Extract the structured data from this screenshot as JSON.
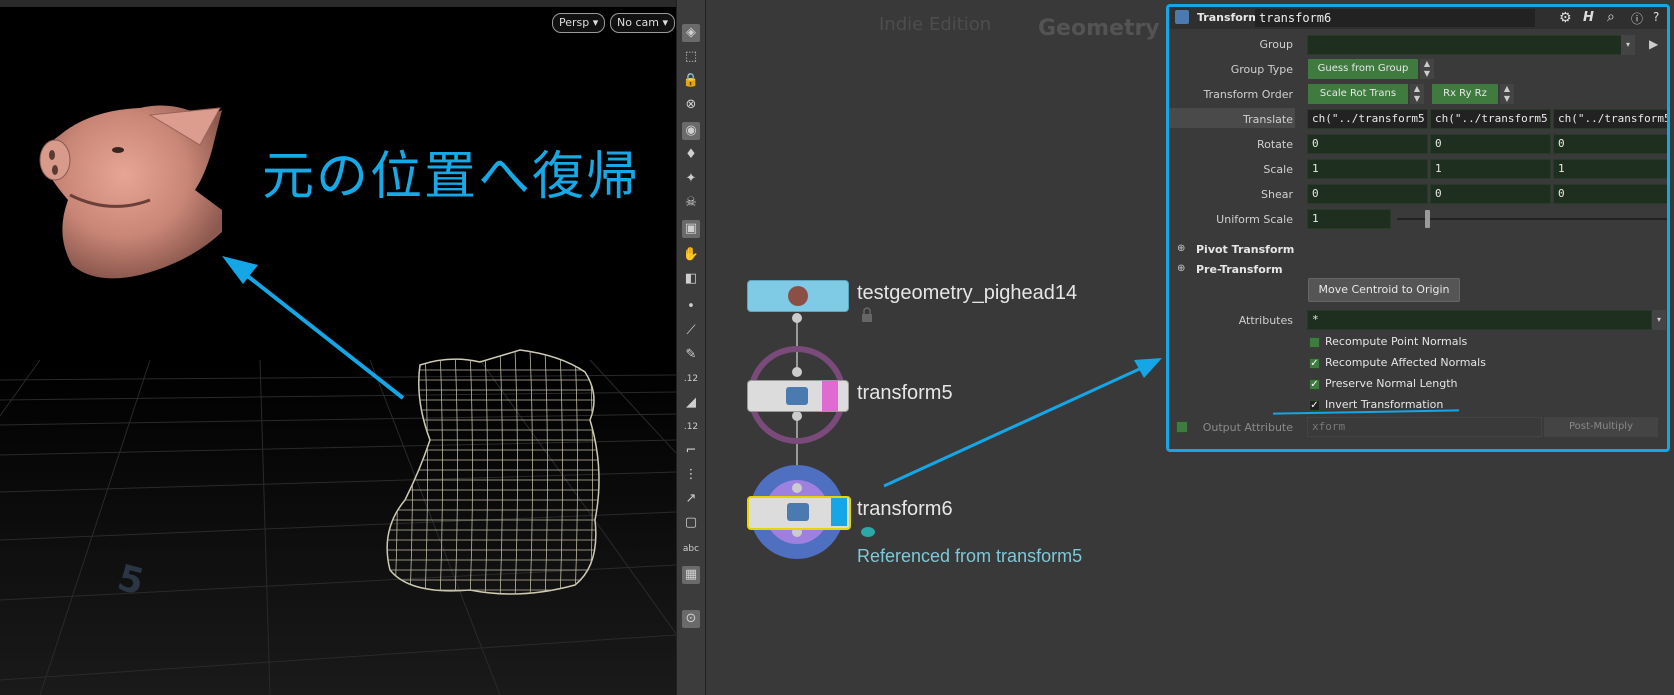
{
  "viewport": {
    "persp_label": "Persp",
    "cam_label": "No cam",
    "overlay_text": "元の位置へ復帰",
    "grid_number": "5"
  },
  "toolbar": {
    "icons": [
      "wireframe-icon",
      "select-icon",
      "lock-icon",
      "snap-icon",
      "display-icon",
      "light-icon",
      "light-add-icon",
      "skull-icon",
      "render-icon",
      "hand-icon",
      "camera-icon",
      "point-icon",
      "brush-icon",
      "pen-icon",
      "number-icon",
      "paint-icon",
      "number2-icon",
      "corner-icon",
      "grid-icon",
      "node-icon",
      "shape-icon",
      "text-icon",
      "image-icon",
      "pin-icon"
    ],
    "abc_label": "abc"
  },
  "network": {
    "edition": "Indie Edition",
    "context_title": "Geometry",
    "nodes": [
      {
        "name": "testgeometry_pighead14",
        "color": "#7fcbe6"
      },
      {
        "name": "transform5",
        "color": "#dcdcdc",
        "flag_color": "#e06ad2"
      },
      {
        "name": "transform6",
        "color": "#dcdcdc",
        "flag_color": "#14a6e6"
      }
    ],
    "reference_text": "Referenced from transform5"
  },
  "params": {
    "node_type": "Transform",
    "node_name": "transform6",
    "group_label": "Group",
    "group_value": "",
    "group_type_label": "Group Type",
    "group_type_value": "Guess from Group",
    "transform_order_label": "Transform Order",
    "transform_order_value": "Scale Rot Trans",
    "rotate_order_value": "Rx Ry Rz",
    "translate_label": "Translate",
    "translate": [
      "ch(\"../transform5",
      "ch(\"../transform5",
      "ch(\"../transform5"
    ],
    "rotate_label": "Rotate",
    "rotate": [
      "0",
      "0",
      "0"
    ],
    "scale_label": "Scale",
    "scale": [
      "1",
      "1",
      "1"
    ],
    "shear_label": "Shear",
    "shear": [
      "0",
      "0",
      "0"
    ],
    "uniform_scale_label": "Uniform Scale",
    "uniform_scale": "1",
    "pivot_transform": "Pivot Transform",
    "pre_transform": "Pre-Transform",
    "move_centroid": "Move Centroid to Origin",
    "attributes_label": "Attributes",
    "attributes_value": "*",
    "recompute_point_normals": "Recompute Point Normals",
    "recompute_affected_normals": "Recompute Affected Normals",
    "preserve_normal_length": "Preserve Normal Length",
    "invert_transformation": "Invert Transformation",
    "output_attribute_label": "Output Attribute",
    "output_attribute_value": "xform",
    "post_multiply": "Post-Multiply",
    "checks": {
      "recompute_point_normals": false,
      "recompute_affected_normals": true,
      "preserve_normal_length": true,
      "invert_transformation": true
    },
    "accent": "#14a6e6"
  }
}
